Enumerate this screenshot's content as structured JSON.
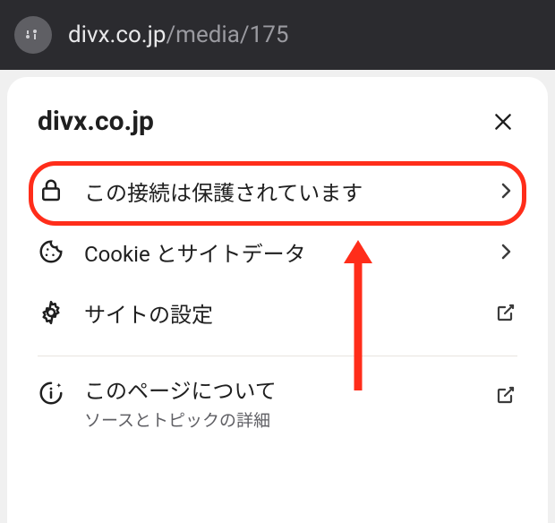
{
  "url": {
    "host": "divx.co.jp",
    "path": "/media/175"
  },
  "panel": {
    "title": "divx.co.jp",
    "rows": {
      "connection": {
        "label": "この接続は保護されています"
      },
      "cookies": {
        "label": "Cookie とサイトデータ"
      },
      "settings": {
        "label": "サイトの設定"
      }
    },
    "about": {
      "title": "このページについて",
      "subtitle": "ソースとトピックの詳細"
    }
  },
  "colors": {
    "highlight": "#ff2d1a"
  }
}
